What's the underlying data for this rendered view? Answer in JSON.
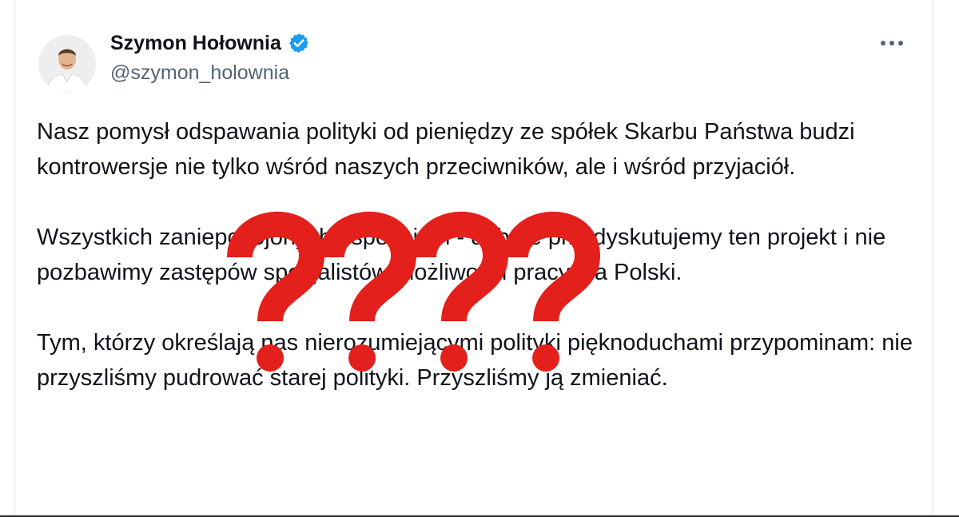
{
  "author": {
    "display_name": "Szymon Hołownia",
    "handle": "@szymon_holownia",
    "verified_icon": "verified-badge-icon",
    "avatar_icon": "avatar-photo"
  },
  "actions": {
    "more_icon": "more-options-icon"
  },
  "tweet": {
    "paragraphs": [
      "Nasz pomysł odspawania polityki od pieniędzy ze spółek Skarbu Państwa budzi kontrowersje nie tylko wśród naszych przeciwników, ale i wśród przyjaciół.",
      "Wszystkich zaniepokojonych uspokajam - dobrze przedyskutujemy ten projekt i nie pozbawimy zastępów specjalistów możliwości pracy dla Polski.",
      "Tym, którzy określają nas nierozumiejącymi polityki pięknoduchami przypominam: nie przyszliśmy pudrować starej polityki. Przyszliśmy ją zmieniać."
    ]
  },
  "overlay": {
    "marks": "????",
    "color": "#e3201b"
  },
  "colors": {
    "verified": "#1d9bf0",
    "handle": "#536471",
    "text": "#0f1419"
  }
}
